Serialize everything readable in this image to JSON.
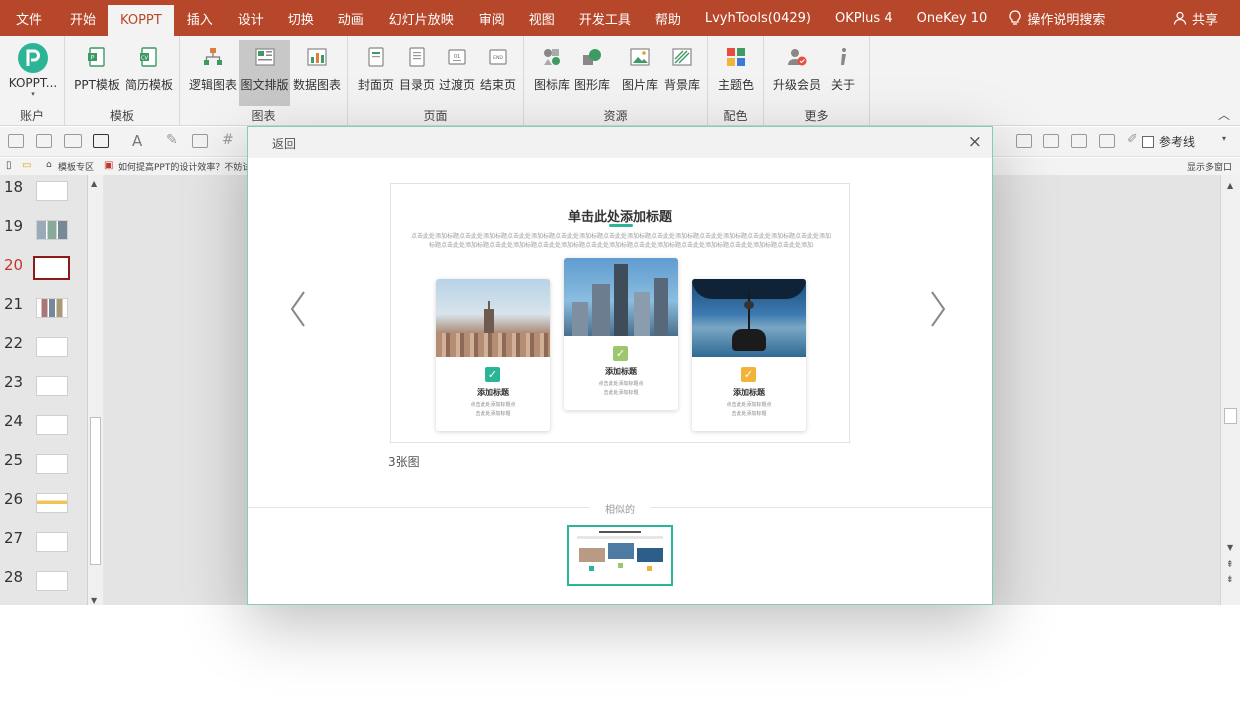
{
  "ribbon_tabs": [
    "文件",
    "开始",
    "KOPPT",
    "插入",
    "设计",
    "切换",
    "动画",
    "幻灯片放映",
    "审阅",
    "视图",
    "开发工具",
    "帮助",
    "LvyhTools(0429)",
    "OKPlus 4",
    "OneKey 10"
  ],
  "active_tab": "KOPPT",
  "search_label": "操作说明搜索",
  "share_label": "共享",
  "ribbon": {
    "account_btn": "KOPPT...",
    "account_group": "账户",
    "template_btn1": "PPT模板",
    "template_btn2": "简历模板",
    "template_group": "模板",
    "chart_btn1": "逻辑图表",
    "chart_btn2": "图文排版",
    "chart_btn3": "数据图表",
    "chart_group": "图表",
    "page_btn1": "封面页",
    "page_btn2": "目录页",
    "page_btn3": "过渡页",
    "page_btn4": "结束页",
    "page_group": "页面",
    "res_btn1": "图标库",
    "res_btn2": "图形库",
    "res_btn3": "图片库",
    "res_btn4": "背景库",
    "res_group": "资源",
    "color_btn": "主题色",
    "color_group": "配色",
    "more_btn1": "升级会员",
    "more_btn2": "关于",
    "more_group": "更多"
  },
  "toolbar2": {
    "guide_label": "参考线"
  },
  "docbar": {
    "tab1": "模板专区",
    "tab2": "如何提高PPT的设计效率？不妨试试这...",
    "right": "显示多窗口"
  },
  "slides": {
    "numbers": [
      "18",
      "19",
      "20",
      "21",
      "22",
      "23",
      "24",
      "25",
      "26",
      "27",
      "28"
    ],
    "current": "20"
  },
  "modal": {
    "back_label": "返回",
    "close_label": "×",
    "preview": {
      "title": "单击此处添加标题",
      "subtitle": "点击此处添加标题点击此处添加标题点击此处添加标题点击此处添加标题点击此处添加标题点击此处添加标题点击此处添加标题点击此处添加标题点击此处添加标题点击此处添加标题点击此处添加标题点击此处添加标题点击此处添加标题点击此处添加标题点击此处添加标题点击此处添加标题点击此处添加",
      "cards": [
        {
          "title": "添加标题",
          "desc1": "点击此处添加标题点",
          "desc2": "击此处添加标题",
          "check_color": "#2bb596"
        },
        {
          "title": "添加标题",
          "desc1": "点击此处添加标题点",
          "desc2": "击此处添加标题",
          "check_color": "#9cc76f"
        },
        {
          "title": "添加标题",
          "desc1": "点击此处添加标题点",
          "desc2": "击此处添加标题",
          "check_color": "#f1b33a"
        }
      ]
    },
    "count_label": "3张图",
    "similar_label": "相似的"
  },
  "colors": {
    "title_bar": "#b7472a",
    "accent_green": "#2bb596"
  }
}
